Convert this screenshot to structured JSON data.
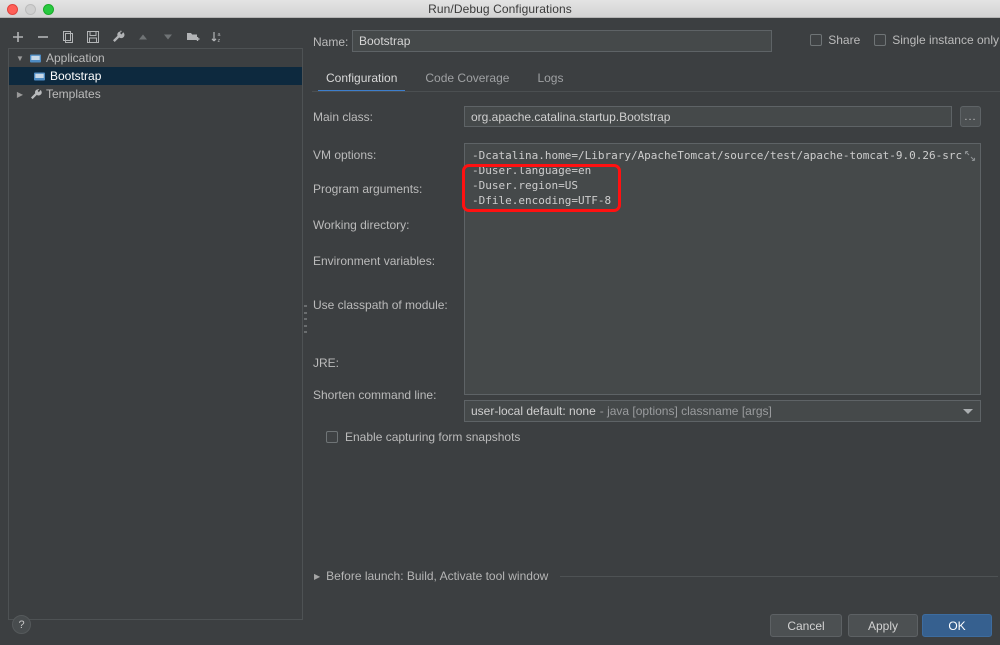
{
  "window": {
    "title": "Run/Debug Configurations",
    "traffic_lights": [
      "close-red",
      "minimize-gray",
      "zoom-green"
    ]
  },
  "sidebar": {
    "toolbar": [
      {
        "name": "add-icon",
        "glyph": "+"
      },
      {
        "name": "remove-icon",
        "glyph": "−"
      },
      {
        "name": "copy-icon",
        "glyph": "⧉"
      },
      {
        "name": "save-icon",
        "glyph": "Ὃe"
      },
      {
        "name": "wrench-icon",
        "glyph": "⚒"
      },
      {
        "name": "move-up-icon",
        "glyph": "▲"
      },
      {
        "name": "move-down-icon",
        "glyph": "▼"
      },
      {
        "name": "new-folder-icon",
        "glyph": "Ὄ1"
      },
      {
        "name": "sort-alphabetically-icon",
        "glyph": "↓az"
      }
    ],
    "tree": [
      {
        "label": "Application",
        "expanded": true,
        "selected": false,
        "level": 0,
        "icon": "application-icon",
        "arrow": "▼"
      },
      {
        "label": "Bootstrap",
        "expanded": false,
        "selected": true,
        "level": 1,
        "icon": "application-icon",
        "arrow": ""
      },
      {
        "label": "Templates",
        "expanded": false,
        "selected": false,
        "level": 0,
        "icon": "wrench-icon",
        "arrow": "▶"
      }
    ]
  },
  "header": {
    "name_label": "Name:",
    "name_value": "Bootstrap",
    "share_label": "Share",
    "share_checked": false,
    "single_instance_label": "Single instance only",
    "single_instance_checked": false
  },
  "tabs": [
    {
      "label": "Configuration",
      "active": true
    },
    {
      "label": "Code Coverage",
      "active": false
    },
    {
      "label": "Logs",
      "active": false
    }
  ],
  "form": {
    "main_class_label": "Main class:",
    "main_class_value": "org.apache.catalina.startup.Bootstrap",
    "browse_label": "...",
    "vm_options_label": "VM options:",
    "vm_options_value": "-Dcatalina.home=/Library/ApacheTomcat/source/test/apache-tomcat-9.0.26-src\n-Duser.language=en\n-Duser.region=US\n-Dfile.encoding=UTF-8",
    "program_arguments_label": "Program arguments:",
    "working_directory_label": "Working directory:",
    "environment_variables_label": "Environment variables:",
    "use_classpath_label": "Use classpath of module:",
    "jre_label": "JRE:",
    "shorten_command_line_label": "Shorten command line:",
    "shorten_command_line_value": "user-local default: none",
    "shorten_command_line_hint": "- java [options] classname [args]",
    "enable_snapshots_label": "Enable capturing form snapshots",
    "enable_snapshots_checked": false,
    "before_launch_label": "Before launch: Build, Activate tool window"
  },
  "highlight": {
    "color": "#ff1111",
    "note": "red annotation rectangle around the three -D user locale options"
  },
  "footer": {
    "help_label": "?",
    "cancel_label": "Cancel",
    "apply_label": "Apply",
    "ok_label": "OK"
  },
  "colors": {
    "background": "#3c3f41",
    "field": "#45494a",
    "selection": "#0d293e",
    "accent": "#3d7ecc",
    "ok_button": "#36608f"
  }
}
